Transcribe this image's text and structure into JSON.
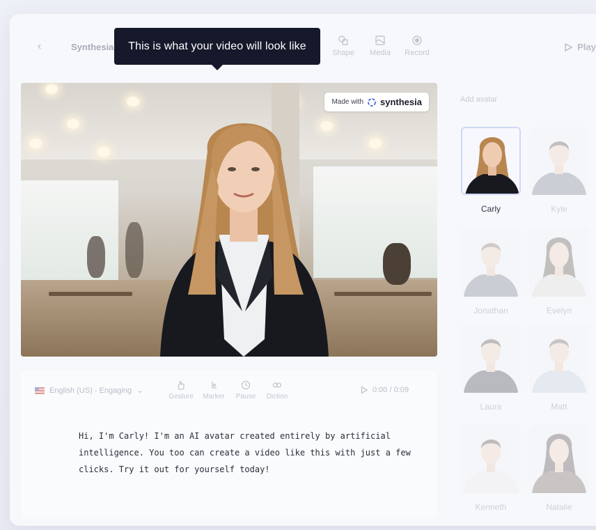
{
  "header": {
    "project_name": "Synthesia",
    "tools": [
      {
        "label": "Shape",
        "icon": "shape-icon"
      },
      {
        "label": "Media",
        "icon": "media-icon"
      },
      {
        "label": "Record",
        "icon": "record-icon"
      }
    ],
    "play_label": "Play"
  },
  "tooltip": {
    "text": "This is what your video will look like"
  },
  "video": {
    "watermark_prefix": "Made with",
    "watermark_brand": "synthesia"
  },
  "editor": {
    "language": "English (US) - Engaging",
    "tools": [
      {
        "label": "Gesture",
        "icon": "gesture-icon"
      },
      {
        "label": "Marker",
        "icon": "marker-icon"
      },
      {
        "label": "Pause",
        "icon": "pause-icon"
      },
      {
        "label": "Diction",
        "icon": "diction-icon"
      }
    ],
    "timer": "0:00 / 0:09",
    "script": "Hi, I'm Carly! I'm an AI avatar created entirely by artificial intelligence. You too can create a video like this with just a few clicks. Try it out for yourself today!"
  },
  "avatars": {
    "title": "Add avatar",
    "items": [
      {
        "name": "Carly",
        "selected": true
      },
      {
        "name": "Kyle",
        "selected": false
      },
      {
        "name": "Jonathan",
        "selected": false
      },
      {
        "name": "Evelyn",
        "selected": false
      },
      {
        "name": "Laura",
        "selected": false
      },
      {
        "name": "Matt",
        "selected": false
      },
      {
        "name": "Kenneth",
        "selected": false
      },
      {
        "name": "Natalie",
        "selected": false
      }
    ]
  }
}
